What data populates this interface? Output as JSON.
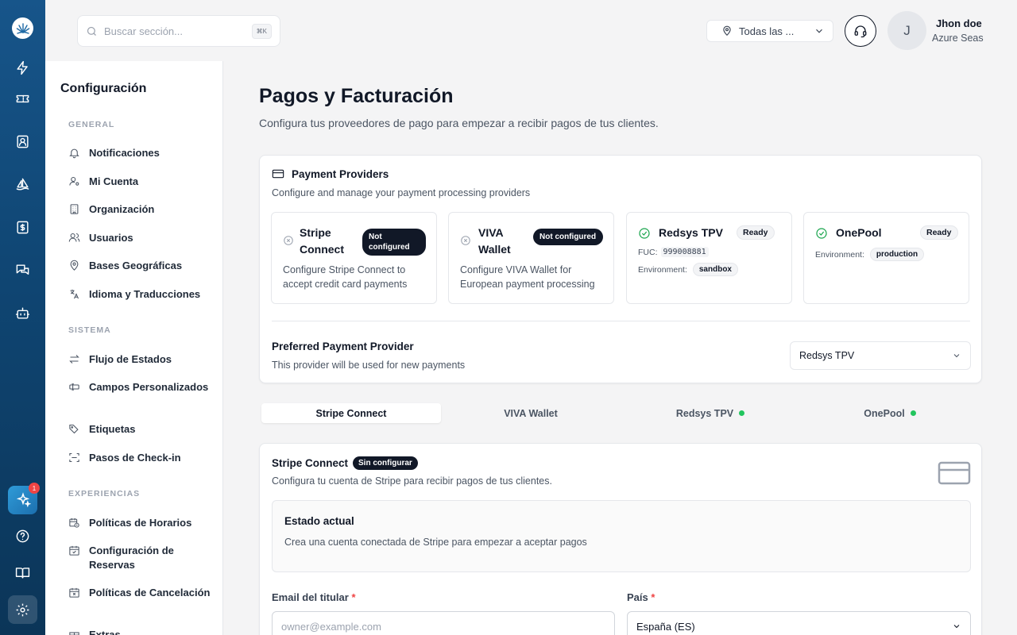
{
  "topbar": {
    "search_placeholder": "Buscar sección...",
    "search_shortcut": "⌘K",
    "location": "Todas las ...",
    "user_initial": "J",
    "user_name": "Jhon doe",
    "user_org": "Azure Seas"
  },
  "rail": {
    "notification_count": "1",
    "icons": [
      "zap-icon",
      "ticket-icon",
      "contacts-icon",
      "sailboat-icon",
      "dollar-icon",
      "messages-icon",
      "bot-icon",
      "sparkles-icon",
      "help-icon",
      "book-icon",
      "settings-icon"
    ]
  },
  "sidebar": {
    "title": "Configuración",
    "sections": [
      {
        "label": "GENERAL",
        "items": [
          "Notificaciones",
          "Mi Cuenta",
          "Organización",
          "Usuarios",
          "Bases Geográficas",
          "Idioma y Traducciones"
        ]
      },
      {
        "label": "SISTEMA",
        "items": [
          "Flujo de Estados",
          "Campos Personalizados",
          "Etiquetas",
          "Pasos de Check-in"
        ]
      },
      {
        "label": "EXPERIENCIAS",
        "items": [
          "Políticas de Horarios",
          "Configuración de Reservas",
          "Políticas de Cancelación",
          "Extras"
        ]
      }
    ]
  },
  "page": {
    "title": "Pagos y Facturación",
    "subtitle": "Configura tus proveedores de pago para empezar a recibir pagos de tus clientes."
  },
  "providers_card": {
    "title": "Payment Providers",
    "description": "Configure and manage your payment processing providers",
    "providers": [
      {
        "name": "Stripe Connect",
        "status": "Not configured",
        "description": "Configure Stripe Connect to accept credit card payments"
      },
      {
        "name": "VIVA Wallet",
        "status": "Not configured",
        "description": "Configure VIVA Wallet for European payment processing"
      },
      {
        "name": "Redsys TPV",
        "status": "Ready",
        "fuc_label": "FUC:",
        "fuc_value": "999008881",
        "env_label": "Environment:",
        "env_value": "sandbox"
      },
      {
        "name": "OnePool",
        "status": "Ready",
        "env_label": "Environment:",
        "env_value": "production"
      }
    ],
    "preferred_title": "Preferred Payment Provider",
    "preferred_subtitle": "This provider will be used for new payments",
    "preferred_value": "Redsys TPV"
  },
  "tabs": [
    {
      "label": "Stripe Connect",
      "active": true
    },
    {
      "label": "VIVA Wallet",
      "active": false
    },
    {
      "label": "Redsys TPV",
      "active": false,
      "status_dot": true
    },
    {
      "label": "OnePool",
      "active": false,
      "status_dot": true
    }
  ],
  "stripe_card": {
    "title": "Stripe Connect",
    "badge": "Sin configurar",
    "description": "Configura tu cuenta de Stripe para recibir pagos de tus clientes.",
    "status_title": "Estado actual",
    "status_text": "Crea una cuenta conectada de Stripe para empezar a aceptar pagos",
    "email_label": "Email del titular",
    "email_placeholder": "owner@example.com",
    "country_label": "País",
    "country_value": "España (ES)",
    "required_mark": "*"
  },
  "colors": {
    "rail_top": "#17558a",
    "rail_bottom": "#0b3558",
    "ready_green": "#16a34a",
    "status_dot": "#22c55e",
    "dark_badge": "#111827",
    "required_red": "#ef4444"
  }
}
